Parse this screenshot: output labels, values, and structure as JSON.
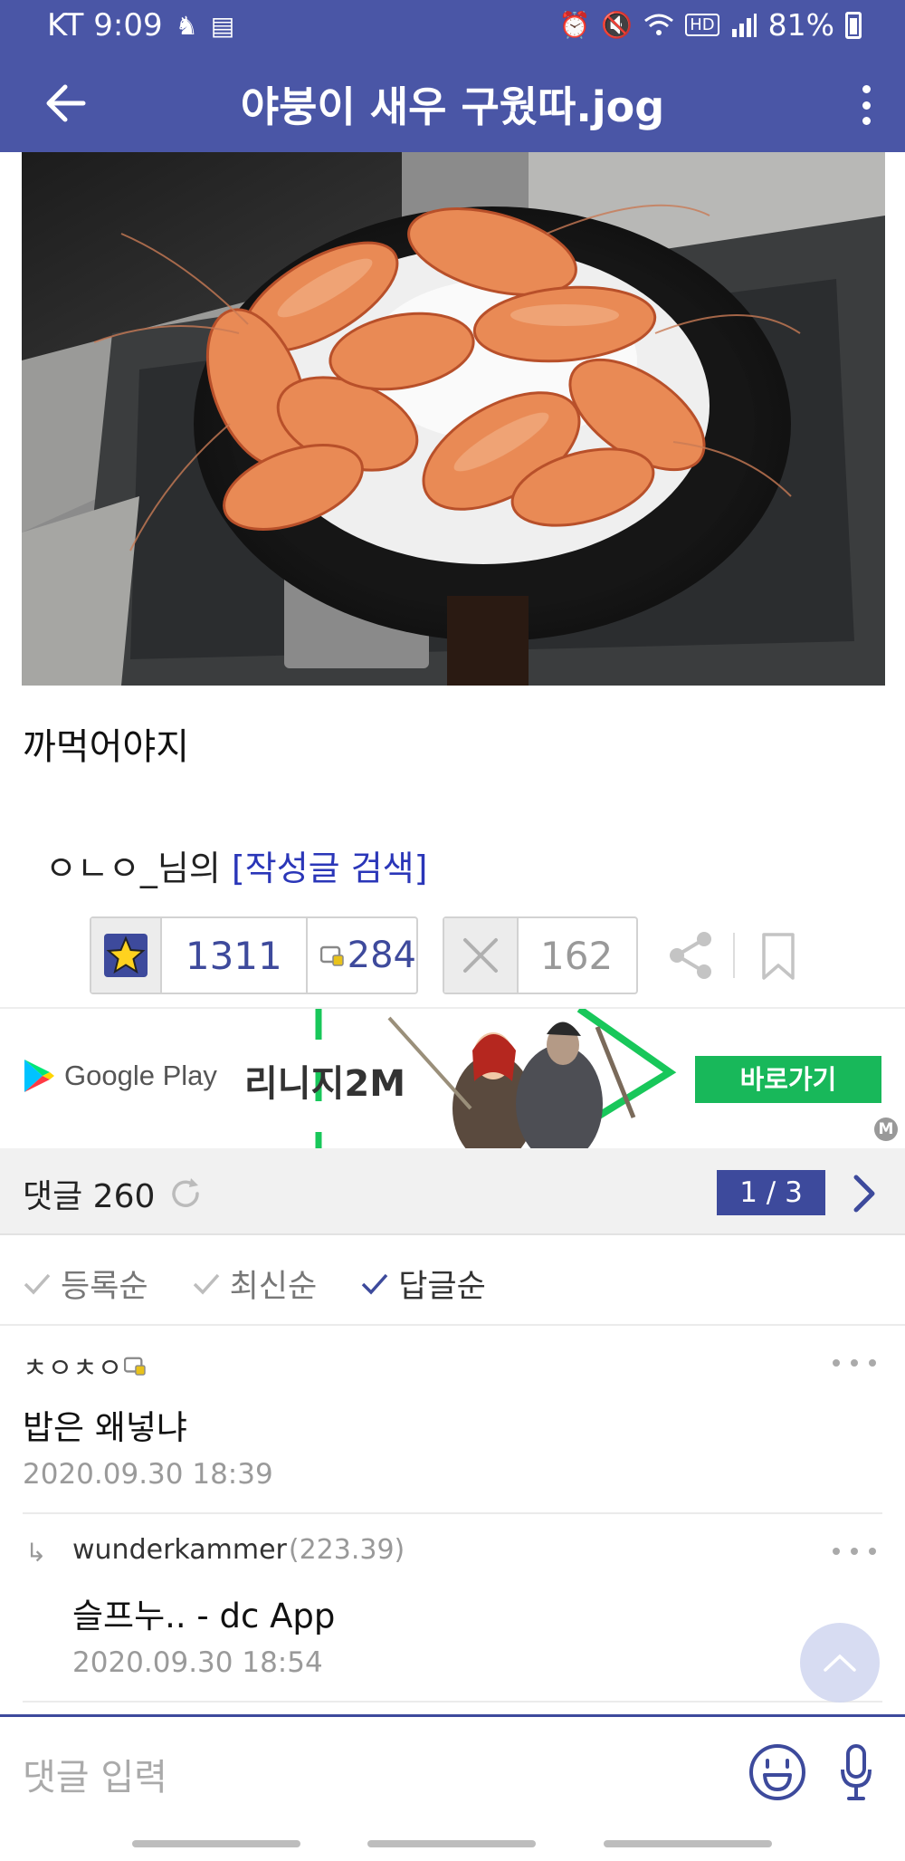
{
  "status_bar": {
    "carrier_time": "KT 9:09",
    "battery": "81%"
  },
  "app_bar": {
    "title": "야붕이 새우 구웠따.jog"
  },
  "post": {
    "body": "까먹어야지",
    "author": "ㅇㄴㅇ_",
    "author_suffix": "님의",
    "search_link": "[작성글 검색]"
  },
  "votes": {
    "recommend": "1311",
    "fixed_recommend": "284",
    "non_recommend": "162"
  },
  "ad": {
    "store": "Google Play",
    "game": "리니지2M",
    "cta": "바로가기",
    "badge": "M"
  },
  "comments_header": {
    "label": "댓글 260",
    "page": "1 / 3"
  },
  "sort_options": [
    {
      "label": "등록순",
      "active": false
    },
    {
      "label": "최신순",
      "active": false
    },
    {
      "label": "답글순",
      "active": true
    }
  ],
  "comments": [
    {
      "nick": "ㅊㅇㅊㅇ",
      "ip": "",
      "body": "밥은 왜넣냐",
      "date": "2020.09.30 18:39"
    },
    {
      "nick": "wunderkammer",
      "ip": "(223.39)",
      "body": "슬프누.. - dc App",
      "date": "2020.09.30 18:54",
      "reply": true
    }
  ],
  "input": {
    "placeholder": "댓글 입력"
  },
  "colors": {
    "brand": "#4a56a6",
    "accent_link": "#2a36b8",
    "ad_cta": "#18b85a"
  }
}
